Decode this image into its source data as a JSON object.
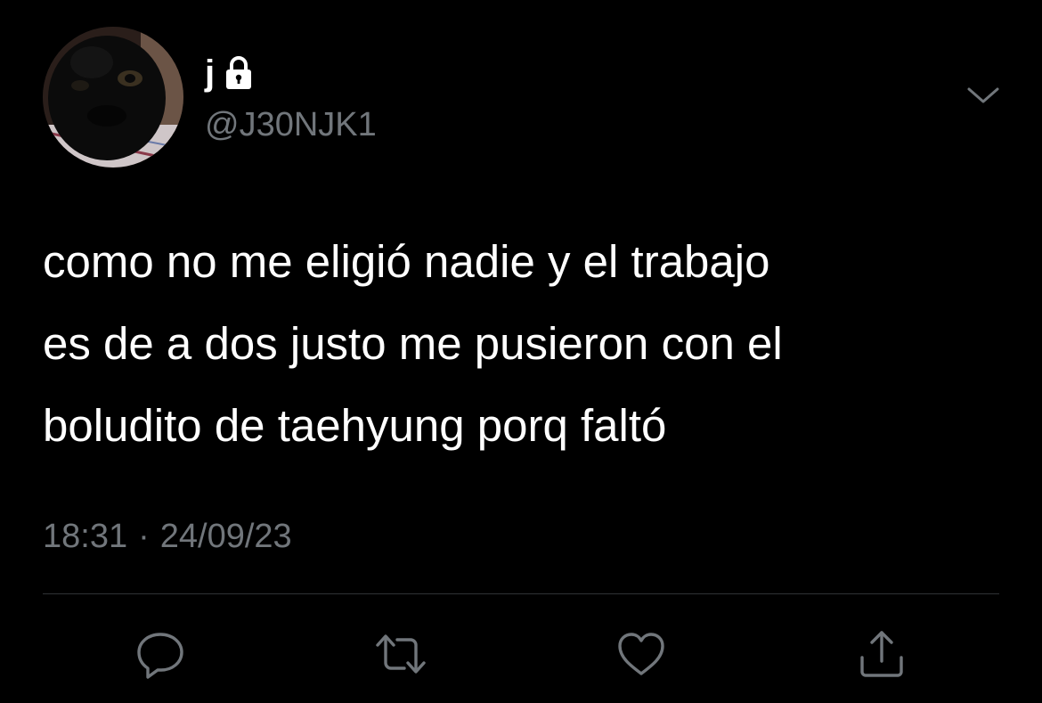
{
  "tweet": {
    "display_name": "j",
    "handle": "@J30NJK1",
    "protected": true,
    "text": "como no me eligió nadie y el trabajo\nes de a dos justo me pusieron con el\nboludito de taehyung porq faltó",
    "time": "18:31",
    "separator": "·",
    "date": "24/09/23"
  },
  "icons": {
    "lock": "lock-icon",
    "more": "chevron-down-icon",
    "reply": "reply-icon",
    "retweet": "retweet-icon",
    "like": "heart-icon",
    "share": "share-icon"
  },
  "colors": {
    "background": "#000000",
    "text": "#ffffff",
    "secondary": "#71767b",
    "divider": "#2f3336"
  }
}
